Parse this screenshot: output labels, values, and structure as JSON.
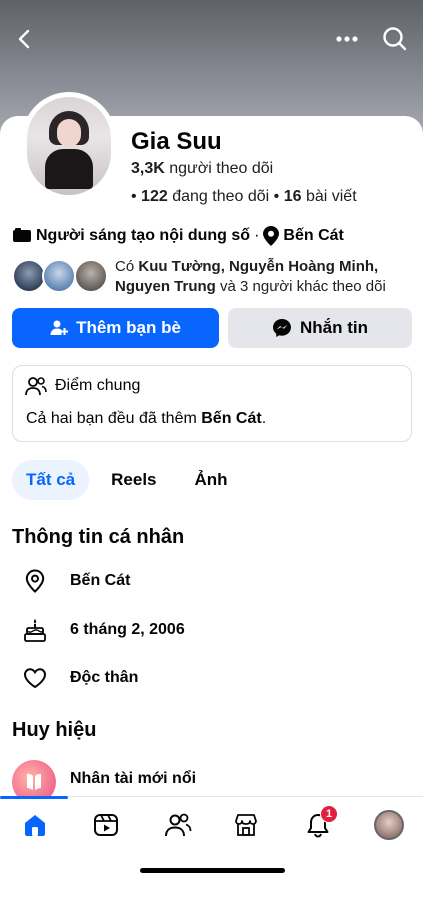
{
  "profile": {
    "name": "Gia Suu",
    "followers_count": "3,3K",
    "followers_label": "người theo dõi",
    "following_count": "122",
    "following_label": "đang theo dõi",
    "posts_count": "16",
    "posts_label": "bài viết",
    "creator_label": "Người sáng tạo nội dung số",
    "location": "Bến Cát"
  },
  "mutual": {
    "prefix": "Có",
    "names": "Kuu Tường, Nguyễn Hoàng Minh,",
    "name3": "Nguyen Trung",
    "suffix": "và 3 người khác theo dõi"
  },
  "actions": {
    "add_friend": "Thêm bạn bè",
    "message": "Nhắn tin"
  },
  "common": {
    "title": "Điểm chung",
    "text_prefix": "Cả hai bạn đều đã thêm",
    "text_bold": "Bến Cát",
    "text_suffix": "."
  },
  "tabs": [
    "Tất cả",
    "Reels",
    "Ảnh"
  ],
  "personal_info": {
    "title": "Thông tin cá nhân",
    "location": "Bến Cát",
    "birthday": "6 tháng 2, 2006",
    "relationship": "Độc thân"
  },
  "badges": {
    "title": "Huy hiệu",
    "item": "Nhân tài mới nổi"
  },
  "tabbar": {
    "notification_count": "1"
  },
  "colors": {
    "primary": "#0866ff",
    "secondary_button": "#e4e6eb",
    "notification": "#e41e3f"
  }
}
